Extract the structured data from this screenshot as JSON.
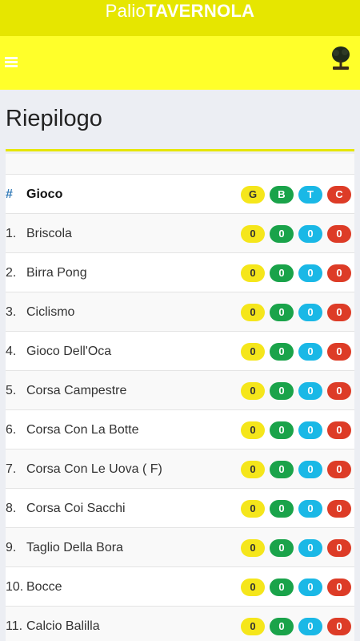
{
  "app": {
    "brand_light": "Palio",
    "brand_bold": "TAVERNOLA"
  },
  "page": {
    "title": "Riepilogo"
  },
  "table": {
    "header": {
      "num": "#",
      "name": "Gioco",
      "g": "G",
      "b": "B",
      "t": "T",
      "c": "C"
    },
    "rows": [
      {
        "num": "1.",
        "name": "Briscola",
        "g": "0",
        "b": "0",
        "t": "0",
        "c": "0"
      },
      {
        "num": "2.",
        "name": "Birra Pong",
        "g": "0",
        "b": "0",
        "t": "0",
        "c": "0"
      },
      {
        "num": "3.",
        "name": "Ciclismo",
        "g": "0",
        "b": "0",
        "t": "0",
        "c": "0"
      },
      {
        "num": "4.",
        "name": "Gioco Dell'Oca",
        "g": "0",
        "b": "0",
        "t": "0",
        "c": "0"
      },
      {
        "num": "5.",
        "name": "Corsa Campestre",
        "g": "0",
        "b": "0",
        "t": "0",
        "c": "0"
      },
      {
        "num": "6.",
        "name": "Corsa Con La Botte",
        "g": "0",
        "b": "0",
        "t": "0",
        "c": "0"
      },
      {
        "num": "7.",
        "name": "Corsa Con Le Uova ( F)",
        "g": "0",
        "b": "0",
        "t": "0",
        "c": "0"
      },
      {
        "num": "8.",
        "name": "Corsa Coi Sacchi",
        "g": "0",
        "b": "0",
        "t": "0",
        "c": "0"
      },
      {
        "num": "9.",
        "name": "Taglio Della Bora",
        "g": "0",
        "b": "0",
        "t": "0",
        "c": "0"
      },
      {
        "num": "10.",
        "name": "Bocce",
        "g": "0",
        "b": "0",
        "t": "0",
        "c": "0"
      },
      {
        "num": "11.",
        "name": "Calcio Balilla",
        "g": "0",
        "b": "0",
        "t": "0",
        "c": "0"
      }
    ]
  },
  "colors": {
    "topbar": "#e6e600",
    "navbar": "#ffff2a",
    "team_g": "#f5e61b",
    "team_b": "#1aa34a",
    "team_t": "#1ab8e6",
    "team_c": "#dd3c27"
  },
  "icons": {
    "menu": "hamburger-menu-icon",
    "logo": "tree-logo-icon"
  }
}
